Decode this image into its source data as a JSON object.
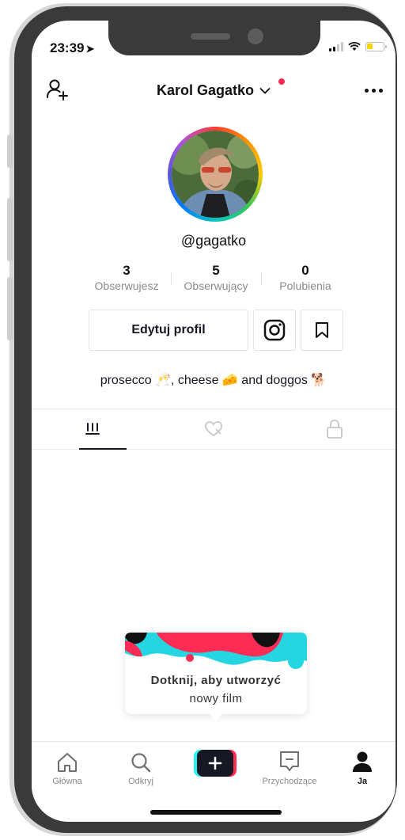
{
  "status_bar": {
    "time": "23:39",
    "battery_color": "#f5d400"
  },
  "header": {
    "title": "Karol Gagatko",
    "notification_dot_color": "#fe2c55"
  },
  "profile": {
    "handle": "@gagatko",
    "stats": [
      {
        "value": "3",
        "label": "Obserwujesz"
      },
      {
        "value": "5",
        "label": "Obserwujący"
      },
      {
        "value": "0",
        "label": "Polubienia"
      }
    ],
    "edit_button": "Edytuj profil",
    "bio": "prosecco 🥂, cheese 🧀 and doggos 🐕"
  },
  "tabs": [
    {
      "icon": "grid-icon",
      "active": true
    },
    {
      "icon": "liked-heart-icon",
      "active": false
    },
    {
      "icon": "lock-icon",
      "active": false
    }
  ],
  "tooltip": {
    "line1": "Dotknij, aby utworzyć",
    "line2": "nowy film"
  },
  "bottom_nav": [
    {
      "label": "Główna",
      "icon": "home-icon"
    },
    {
      "label": "Odkryj",
      "icon": "search-icon"
    },
    {
      "label": "",
      "icon": "create-plus-icon"
    },
    {
      "label": "Przychodzące",
      "icon": "inbox-icon"
    },
    {
      "label": "Ja",
      "icon": "profile-icon",
      "active": true
    }
  ],
  "colors": {
    "accent_red": "#fe2c55",
    "accent_cyan": "#25f4ee",
    "text": "#161823"
  }
}
